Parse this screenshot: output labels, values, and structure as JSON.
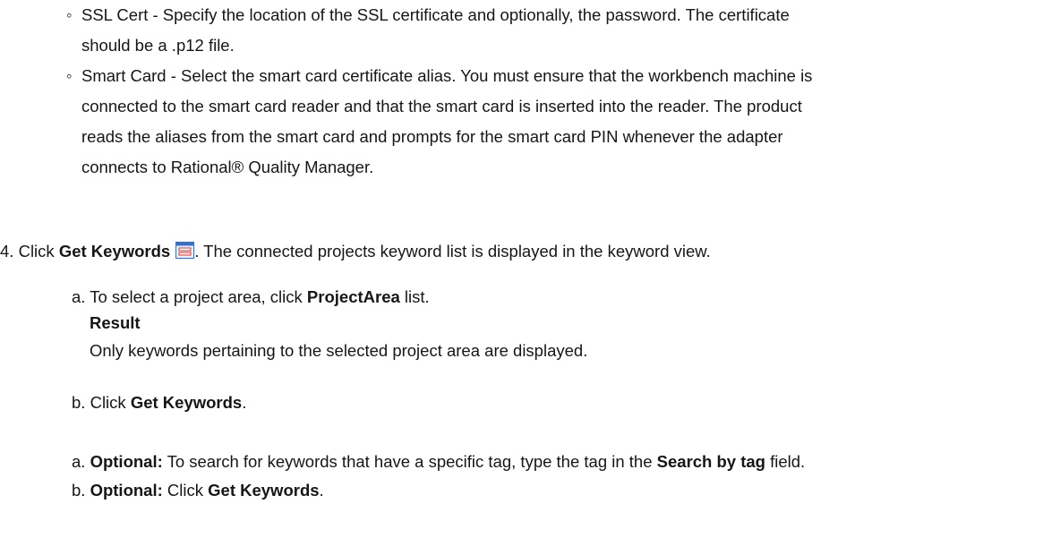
{
  "bullets": [
    {
      "marker": "◦",
      "lines": [
        "SSL Cert - Specify the location of the SSL certificate and optionally, the password. The certificate",
        "should be a .p12 file."
      ]
    },
    {
      "marker": "◦",
      "lines": [
        "Smart Card - Select the smart card certificate alias. You must ensure that the workbench machine is",
        "connected to the smart card reader and that the smart card is inserted into the reader. The product",
        "reads the aliases from the smart card and prompts for the smart card PIN whenever the adapter",
        "connects to  Rational® Quality Manager."
      ]
    }
  ],
  "step4": {
    "number": "4.",
    "pre": "Click ",
    "bold": "Get Keywords",
    "icon": "keywords-window-icon",
    "post": ". The connected projects keyword list is displayed in the keyword view."
  },
  "substeps": [
    {
      "letter": "a.",
      "pre": "To select a project area, click ",
      "bold": "ProjectArea",
      "post": " list."
    },
    {
      "result_label": "Result"
    },
    {
      "text": "Only keywords pertaining to the selected project area are displayed."
    },
    {
      "letter": "b.",
      "pre": "Click ",
      "bold": "Get Keywords",
      "post": "."
    },
    {
      "letter": "a.",
      "bold_pre": "Optional:",
      "pre": " To search for keywords that have a specific tag, type the tag in the ",
      "bold": "Search by tag",
      "post": "  field."
    },
    {
      "letter": "b.",
      "bold_pre": "Optional:",
      "pre": " Click ",
      "bold": "Get Keywords",
      "post": "."
    }
  ],
  "colors": {
    "text": "#161616",
    "icon_blue": "#3a6fc4",
    "icon_red": "#d9362b"
  }
}
